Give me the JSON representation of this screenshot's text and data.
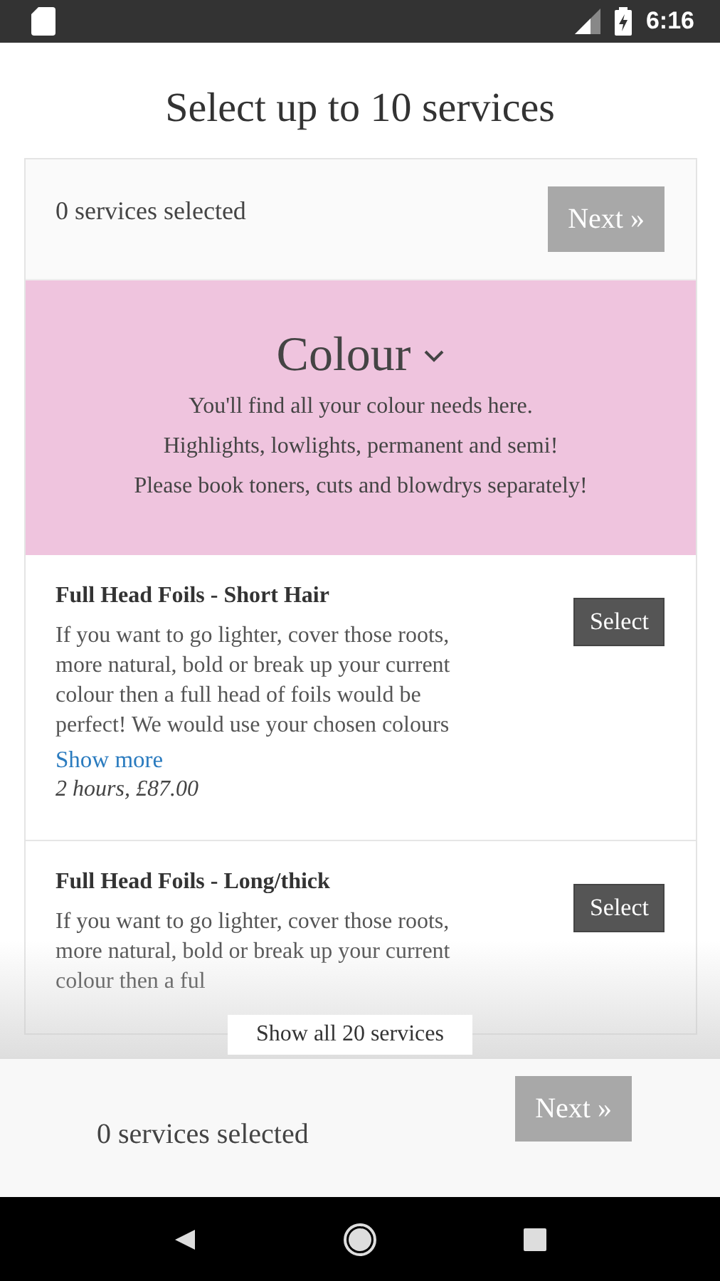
{
  "status_bar": {
    "time": "6:16"
  },
  "title": "Select up to 10 services",
  "selection_bar": {
    "count_text": "0 services selected",
    "next_button": {
      "label": "Next »",
      "disabled": true
    }
  },
  "category": {
    "name": "Colour",
    "expanded": true,
    "lines": [
      "You'll find all your colour needs here.",
      "Highlights, lowlights, permanent and semi!",
      "Please book toners, cuts and blowdrys separately!"
    ]
  },
  "services": [
    {
      "name": "Full Head Foils - Short Hair",
      "description": "If you want to go lighter, cover those roots, more natural, bold or break up your current colour then a full head of foils would be perfect! We would use your chosen colours",
      "show_more": "Show more",
      "duration_price": "2 hours, £87.00",
      "button": "Select"
    },
    {
      "name": "Full Head Foils - Long/thick",
      "description": "If you want to go lighter, cover those roots, more natural, bold or break up your current colour then a ful",
      "button": "Select"
    }
  ],
  "show_all_button": "Show all 20 services",
  "bottom_bar": {
    "count_text": "0 services selected",
    "next_button": {
      "label": "Next »",
      "disabled": true
    }
  }
}
